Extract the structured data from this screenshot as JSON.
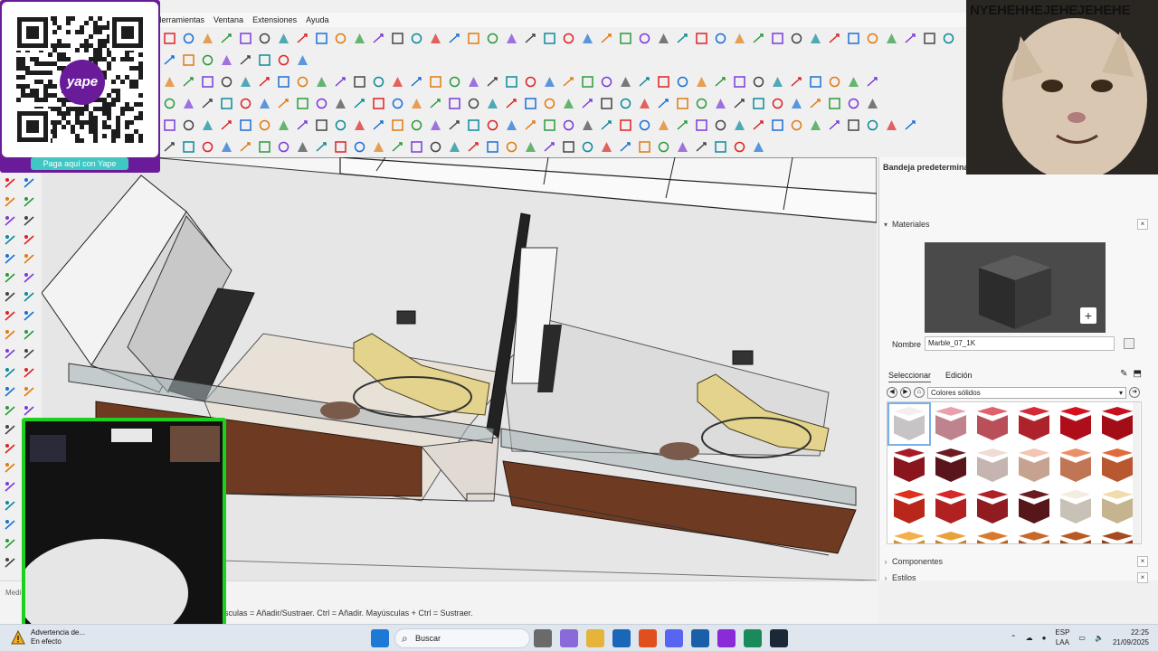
{
  "menu": {
    "items": [
      "Herramientas",
      "Ventana",
      "Extensiones",
      "Ayuda"
    ]
  },
  "overlay": {
    "yape_text": "yape",
    "qr_cta": "Paga aquí con Yape",
    "meme_caption": "NYEHEHHEJEHEJEHEHE"
  },
  "tray_panel": {
    "title": "Bandeja predeterminada",
    "materials_header": "Materiales",
    "name_label": "Nombre",
    "material_name": "Marble_07_1K",
    "tab_select": "Seleccionar",
    "tab_edit": "Edición",
    "library": "Colores sólidos",
    "components_header": "Componentes",
    "styles_header": "Estilos",
    "swatch_colors": [
      "#f4eef0",
      "#e8a0ac",
      "#e0606c",
      "#d42a36",
      "#d4101e",
      "#c6101c",
      "#a81a24",
      "#6e1a22",
      "#f0dcd6",
      "#f2c6b0",
      "#ea9068",
      "#e06a3a",
      "#e0301e",
      "#d8282a",
      "#b02228",
      "#6a1c20",
      "#f4ecde",
      "#f0dcae",
      "#f2b04a",
      "#e8a23a",
      "#d87a2a",
      "#c8682a",
      "#b85a26",
      "#a84a20"
    ]
  },
  "status": {
    "medi": "Medi",
    "hint": "sculas = Añadir/Sustraer. Ctrl = Añadir. Mayúsculas + Ctrl = Sustraer."
  },
  "taskbar": {
    "warning_title": "Advertencia de...",
    "warning_sub": "En efecto",
    "search_placeholder": "Buscar",
    "lang_top": "ESP",
    "lang_bottom": "LAA",
    "time": "22:25",
    "date": "21/09/2025"
  },
  "colors": {
    "accent": "#6a1b9a",
    "cam_border": "#1ed01e",
    "qr_cta": "#3fc7c4"
  }
}
